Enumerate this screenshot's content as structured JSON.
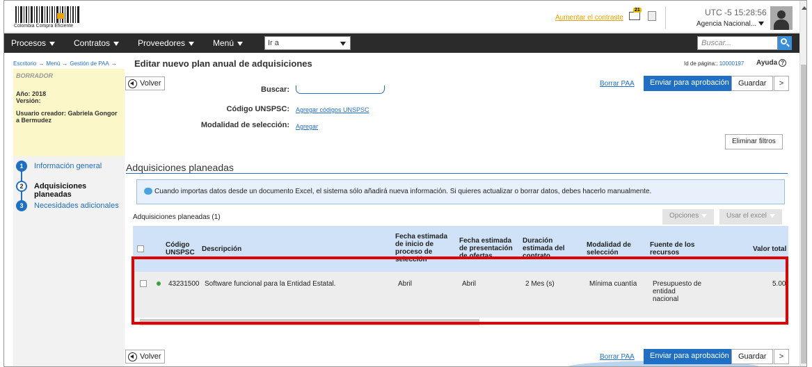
{
  "header": {
    "logo_text": "Colombia Compra Eficiente",
    "contrast_link": "Aumentar el contraste",
    "mail_badge": "21",
    "utc": "UTC -5 15:28:56",
    "agency": "Agencia Nacional..."
  },
  "nav": {
    "items": [
      "Procesos",
      "Contratos",
      "Proveedores",
      "Menú"
    ],
    "goto_value": "Ir a",
    "search_placeholder": "Buscar..."
  },
  "breadcrumb": {
    "items": [
      "Escritorio",
      "Menú",
      "Gestión de PAA"
    ],
    "separator": "→"
  },
  "page": {
    "title": "Editar nuevo plan anual de adquisiciones",
    "id_label": "Id de página::",
    "id_value": "10000197",
    "help": "Ayuda",
    "help_glyph": "?"
  },
  "sidebar": {
    "status": "BORRADOR",
    "year": "Año: 2018",
    "version": "Versión:",
    "creator": "Usuario creador: Gabriela Gongor a Bermudez",
    "steps": [
      {
        "num": "1",
        "label": "Información general"
      },
      {
        "num": "2",
        "label": "Adquisiciones planeadas"
      },
      {
        "num": "3",
        "label": "Necesidades adicionales"
      }
    ]
  },
  "actions": {
    "back": "Volver",
    "delete": "Borrar PAA",
    "send": "Enviar para aprobación",
    "save": "Guardar",
    "more": ">",
    "clear_filters": "Eliminar filtros"
  },
  "filters": {
    "search_label": "Buscar:",
    "unspsc_label": "Código UNSPSC:",
    "unspsc_link": "Agregar códigos UNSPSC",
    "modality_label": "Modalidad de selección:",
    "modality_link": "Agregar"
  },
  "section": {
    "title": "Adquisiciones planeadas",
    "notice": "Cuando importas datos desde un documento Excel, el sistema sólo añadirá nueva información. Si quieres actualizar o borrar datos, debes hacerlo manualmente.",
    "list_label": "Adquisiciones planeadas (1)",
    "options_btn": "Opciones",
    "excel_btn": "Usar el excel"
  },
  "table": {
    "columns": {
      "code": "Código UNSPSC",
      "desc": "Descripción",
      "start": "Fecha estimada de inicio de proceso de selección",
      "present": "Fecha estimada de presentación de ofertas",
      "duration": "Duración estimada del contrato",
      "modality": "Modalidad de selección",
      "source": "Fuente de los recursos",
      "value": "Valor total"
    },
    "rows": [
      {
        "code": "43231500",
        "desc": "Software funcional para la Entidad Estatal.",
        "start": "Abril",
        "present": "Abril",
        "duration": "2 Mes (s)",
        "modality": "Mínima cuantía",
        "source": "Presupuesto de entidad nacional",
        "value": "5.00"
      }
    ]
  },
  "colors": {
    "accent": "#1f6fc5",
    "navbar": "#2b2b2b",
    "highlight": "#e40000",
    "draft_bg": "#fbf7c8"
  }
}
